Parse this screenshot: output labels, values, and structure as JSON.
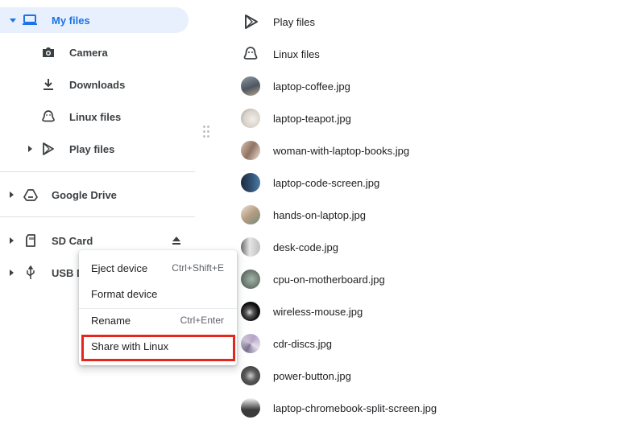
{
  "colors": {
    "accent": "#1a73e8",
    "selected_bg": "#e8f0fe",
    "highlight": "#e4261c"
  },
  "sidebar": {
    "my_files": {
      "label": "My files",
      "icon": "laptop-icon"
    },
    "children": [
      {
        "label": "Camera",
        "icon": "camera-icon"
      },
      {
        "label": "Downloads",
        "icon": "download-icon"
      },
      {
        "label": "Linux files",
        "icon": "linux-penguin-icon"
      },
      {
        "label": "Play files",
        "icon": "play-store-icon"
      }
    ],
    "google_drive": {
      "label": "Google Drive",
      "icon": "google-drive-icon"
    },
    "sd_card": {
      "label": "SD Card",
      "icon": "sd-card-icon",
      "eject_icon": "eject-icon"
    },
    "usb_drive": {
      "label": "USB D",
      "icon": "usb-icon"
    }
  },
  "files": [
    {
      "name": "Play files",
      "icon": "play-store-icon"
    },
    {
      "name": "Linux files",
      "icon": "linux-penguin-icon"
    },
    {
      "name": "laptop-coffee.jpg"
    },
    {
      "name": "laptop-teapot.jpg"
    },
    {
      "name": "woman-with-laptop-books.jpg"
    },
    {
      "name": "laptop-code-screen.jpg"
    },
    {
      "name": "hands-on-laptop.jpg"
    },
    {
      "name": "desk-code.jpg"
    },
    {
      "name": "cpu-on-motherboard.jpg"
    },
    {
      "name": "wireless-mouse.jpg"
    },
    {
      "name": "cdr-discs.jpg"
    },
    {
      "name": "power-button.jpg"
    },
    {
      "name": "laptop-chromebook-split-screen.jpg"
    }
  ],
  "context_menu": {
    "eject": {
      "label": "Eject device",
      "shortcut": "Ctrl+Shift+E"
    },
    "format": {
      "label": "Format device"
    },
    "rename": {
      "label": "Rename",
      "shortcut": "Ctrl+Enter"
    },
    "share": {
      "label": "Share with Linux"
    }
  }
}
